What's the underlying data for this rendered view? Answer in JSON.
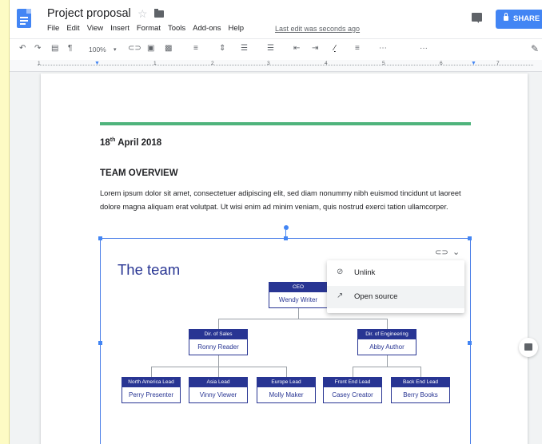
{
  "doc": {
    "title": "Project proposal",
    "last_edit": "Last edit was seconds ago"
  },
  "menu": [
    "File",
    "Edit",
    "View",
    "Insert",
    "Format",
    "Tools",
    "Add-ons",
    "Help"
  ],
  "share": {
    "label": "SHARE"
  },
  "toolbar": {
    "zoom": "100%"
  },
  "ruler": {
    "numbers": [
      "1",
      "1",
      "2",
      "3",
      "4",
      "5",
      "6",
      "7"
    ]
  },
  "content": {
    "date_day": "18",
    "date_suffix": "th",
    "date_rest": "April 2018",
    "section_title": "TEAM OVERVIEW",
    "paragraph": "Lorem ipsum dolor sit amet, consectetuer adipiscing elit, sed diam nonummy nibh euismod tincidunt ut laoreet dolore magna aliquam erat volutpat. Ut wisi enim ad minim veniam, quis nostrud exerci tation ullamcorper."
  },
  "drawing": {
    "title": "The team"
  },
  "popup": {
    "unlink": "Unlink",
    "open_source": "Open source"
  },
  "org": {
    "ceo": {
      "role": "CEO",
      "name": "Wendy Writer"
    },
    "sales": {
      "role": "Dir. of Sales",
      "name": "Ronny Reader"
    },
    "engineering": {
      "role": "Dir. of Engineering",
      "name": "Abby Author"
    },
    "leads": [
      {
        "role": "North America Lead",
        "name": "Perry Presenter"
      },
      {
        "role": "Asia Lead",
        "name": "Vinny Viewer"
      },
      {
        "role": "Europe Lead",
        "name": "Molly Maker"
      },
      {
        "role": "Front End Lead",
        "name": "Casey Creator"
      },
      {
        "role": "Back End Lead",
        "name": "Berry Books"
      }
    ]
  },
  "colors": {
    "accent": "#4285f4",
    "org": "#283593",
    "rule": "#4fb47c"
  }
}
